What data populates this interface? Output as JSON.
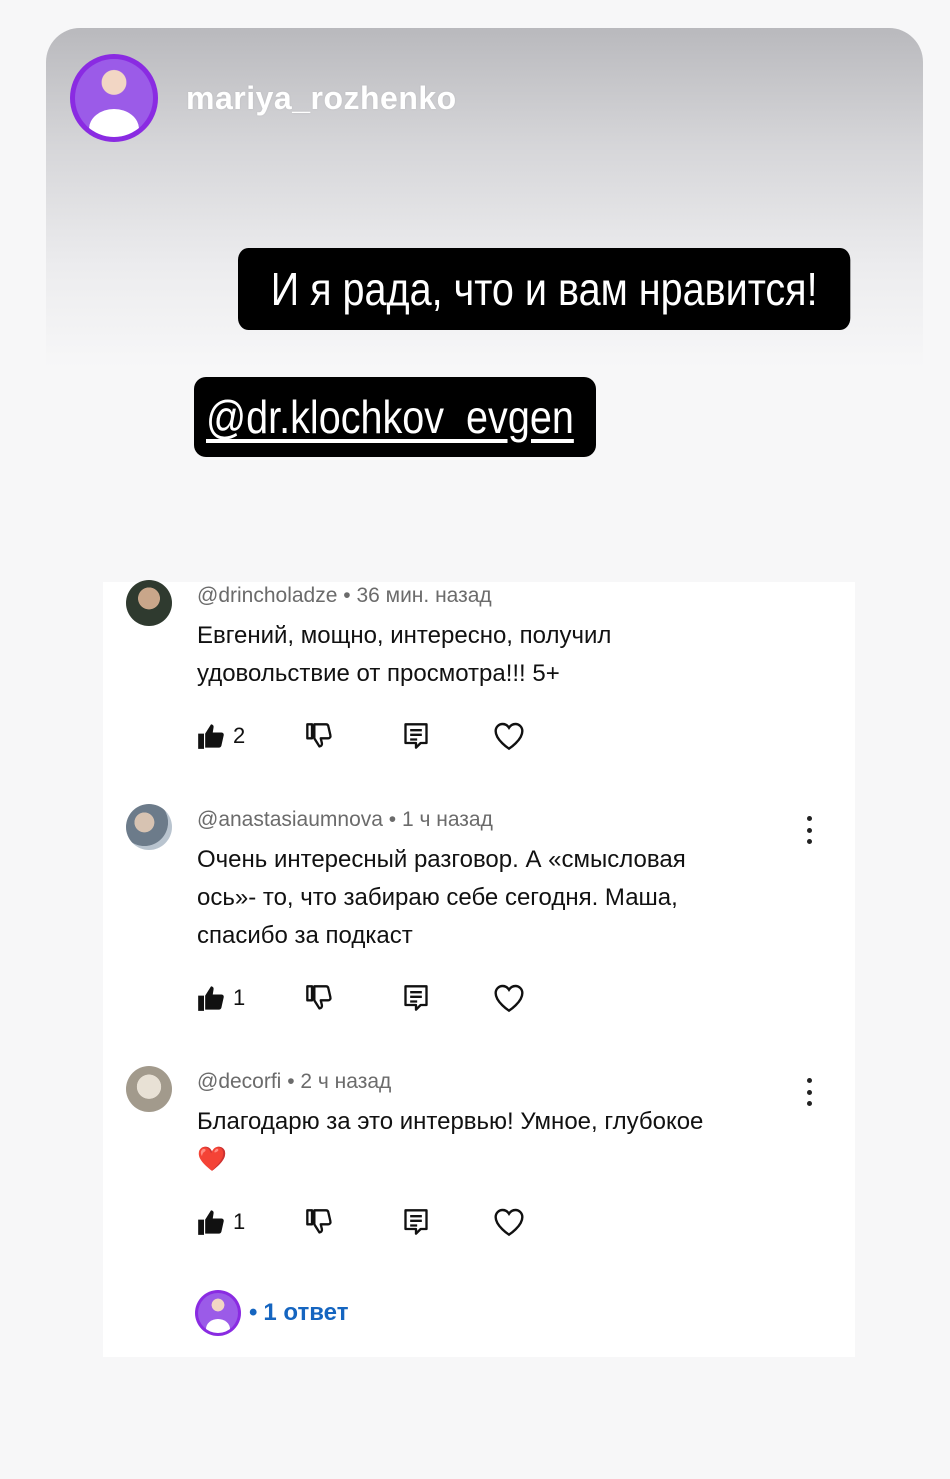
{
  "story": {
    "username": "mariya_rozhenko",
    "sticker_text": "И я рада, что и вам нравится!",
    "mention": "@dr.klochkov_evgen"
  },
  "comments": [
    {
      "author": "@drincholadze",
      "time": "36 мин. назад",
      "text_line1": "Евгений, мощно, интересно, получил",
      "text_line2": "удовольствие от просмотра!!! 5+",
      "likes": "2"
    },
    {
      "author": "@anastasiaumnova",
      "time": "1 ч назад",
      "text_line1": "Очень интересный разговор. А «смысловая",
      "text_line2": "ось»- то, что забираю себе сегодня. Маша,",
      "text_line3": "спасибо за подкаст",
      "likes": "1"
    },
    {
      "author": "@decorfi",
      "time": "2 ч назад",
      "text_line1": "Благодарю за это интервью! Умное, глубокое",
      "text_line2": "❤️",
      "likes": "1"
    }
  ],
  "replies": {
    "label": "1 ответ"
  },
  "colors": {
    "story_avatar_ring": "#8a2be2",
    "reply_link": "#1565c0",
    "sticker_bg": "#000000"
  }
}
